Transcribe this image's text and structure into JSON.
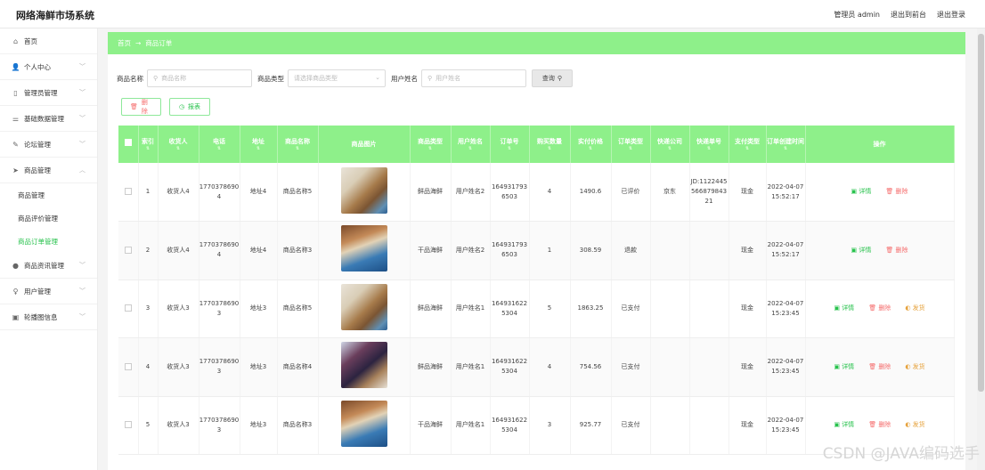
{
  "header": {
    "app_title": "网络海鲜市场系统",
    "user": "管理员 admin",
    "to_front": "退出到前台",
    "logout": "退出登录"
  },
  "sidebar": {
    "items": [
      {
        "label": "首页",
        "icon": "home-icon",
        "chevron": false
      },
      {
        "label": "个人中心",
        "icon": "user-icon",
        "chevron": true
      },
      {
        "label": "管理员管理",
        "icon": "phone-icon",
        "chevron": true
      },
      {
        "label": "基础数据管理",
        "icon": "sliders-icon",
        "chevron": true
      },
      {
        "label": "论坛管理",
        "icon": "forum-icon",
        "chevron": true
      },
      {
        "label": "商品管理",
        "icon": "send-icon",
        "chevron": true,
        "expanded": true
      }
    ],
    "sub_items": [
      "商品管理",
      "商品评价管理",
      "商品订单管理"
    ],
    "items_after": [
      {
        "label": "商品资讯管理",
        "icon": "drop-icon",
        "chevron": true
      },
      {
        "label": "用户管理",
        "icon": "mic-icon",
        "chevron": true
      },
      {
        "label": "轮播图信息",
        "icon": "image-icon",
        "chevron": true
      }
    ]
  },
  "breadcrumb": {
    "home": "首页",
    "sep": "→",
    "current": "商品订单"
  },
  "filters": {
    "name_label": "商品名称",
    "name_placeholder": "商品名称",
    "type_label": "商品类型",
    "type_placeholder": "请选择商品类型",
    "user_label": "用户姓名",
    "user_placeholder": "用户姓名",
    "query": "查询"
  },
  "actions": {
    "delete": "删除",
    "report": "报表"
  },
  "table": {
    "headers": [
      "索引",
      "收货人",
      "电话",
      "地址",
      "商品名称",
      "商品图片",
      "商品类型",
      "用户姓名",
      "订单号",
      "购买数量",
      "实付价格",
      "订单类型",
      "快递公司",
      "快递单号",
      "支付类型",
      "订单创建时间",
      "操作"
    ],
    "rows": [
      {
        "idx": "1",
        "receiver": "收货人4",
        "phone": "17703786904",
        "addr": "地址4",
        "goods": "商品名称5",
        "img": "img1",
        "type": "鲜品海鲜",
        "user": "用户姓名2",
        "order": "1649317936503",
        "qty": "4",
        "price": "1490.6",
        "status": "已评价",
        "express": "京东",
        "express_no": "JD:112244556687984321",
        "pay": "现金",
        "time": "2022-04-07 15:52:17",
        "pay_btn": false
      },
      {
        "idx": "2",
        "receiver": "收货人4",
        "phone": "17703786904",
        "addr": "地址4",
        "goods": "商品名称3",
        "img": "img2",
        "type": "干品海鲜",
        "user": "用户姓名2",
        "order": "1649317936503",
        "qty": "1",
        "price": "308.59",
        "status": "退款",
        "express": "",
        "express_no": "",
        "pay": "现金",
        "time": "2022-04-07 15:52:17",
        "pay_btn": false
      },
      {
        "idx": "3",
        "receiver": "收货人3",
        "phone": "17703786903",
        "addr": "地址3",
        "goods": "商品名称5",
        "img": "img1",
        "type": "鲜品海鲜",
        "user": "用户姓名1",
        "order": "1649316225304",
        "qty": "5",
        "price": "1863.25",
        "status": "已支付",
        "express": "",
        "express_no": "",
        "pay": "现金",
        "time": "2022-04-07 15:23:45",
        "pay_btn": true
      },
      {
        "idx": "4",
        "receiver": "收货人3",
        "phone": "17703786903",
        "addr": "地址3",
        "goods": "商品名称4",
        "img": "img3",
        "type": "鲜品海鲜",
        "user": "用户姓名1",
        "order": "1649316225304",
        "qty": "4",
        "price": "754.56",
        "status": "已支付",
        "express": "",
        "express_no": "",
        "pay": "现金",
        "time": "2022-04-07 15:23:45",
        "pay_btn": true
      },
      {
        "idx": "5",
        "receiver": "收货人3",
        "phone": "17703786903",
        "addr": "地址3",
        "goods": "商品名称3",
        "img": "img2",
        "type": "干品海鲜",
        "user": "用户姓名1",
        "order": "1649316225304",
        "qty": "3",
        "price": "925.77",
        "status": "已支付",
        "express": "",
        "express_no": "",
        "pay": "现金",
        "time": "2022-04-07 15:23:45",
        "pay_btn": true
      }
    ],
    "op_detail": "详情",
    "op_delete": "删除",
    "op_pay": "发货"
  },
  "watermark": "CSDN @JAVA编码选手"
}
